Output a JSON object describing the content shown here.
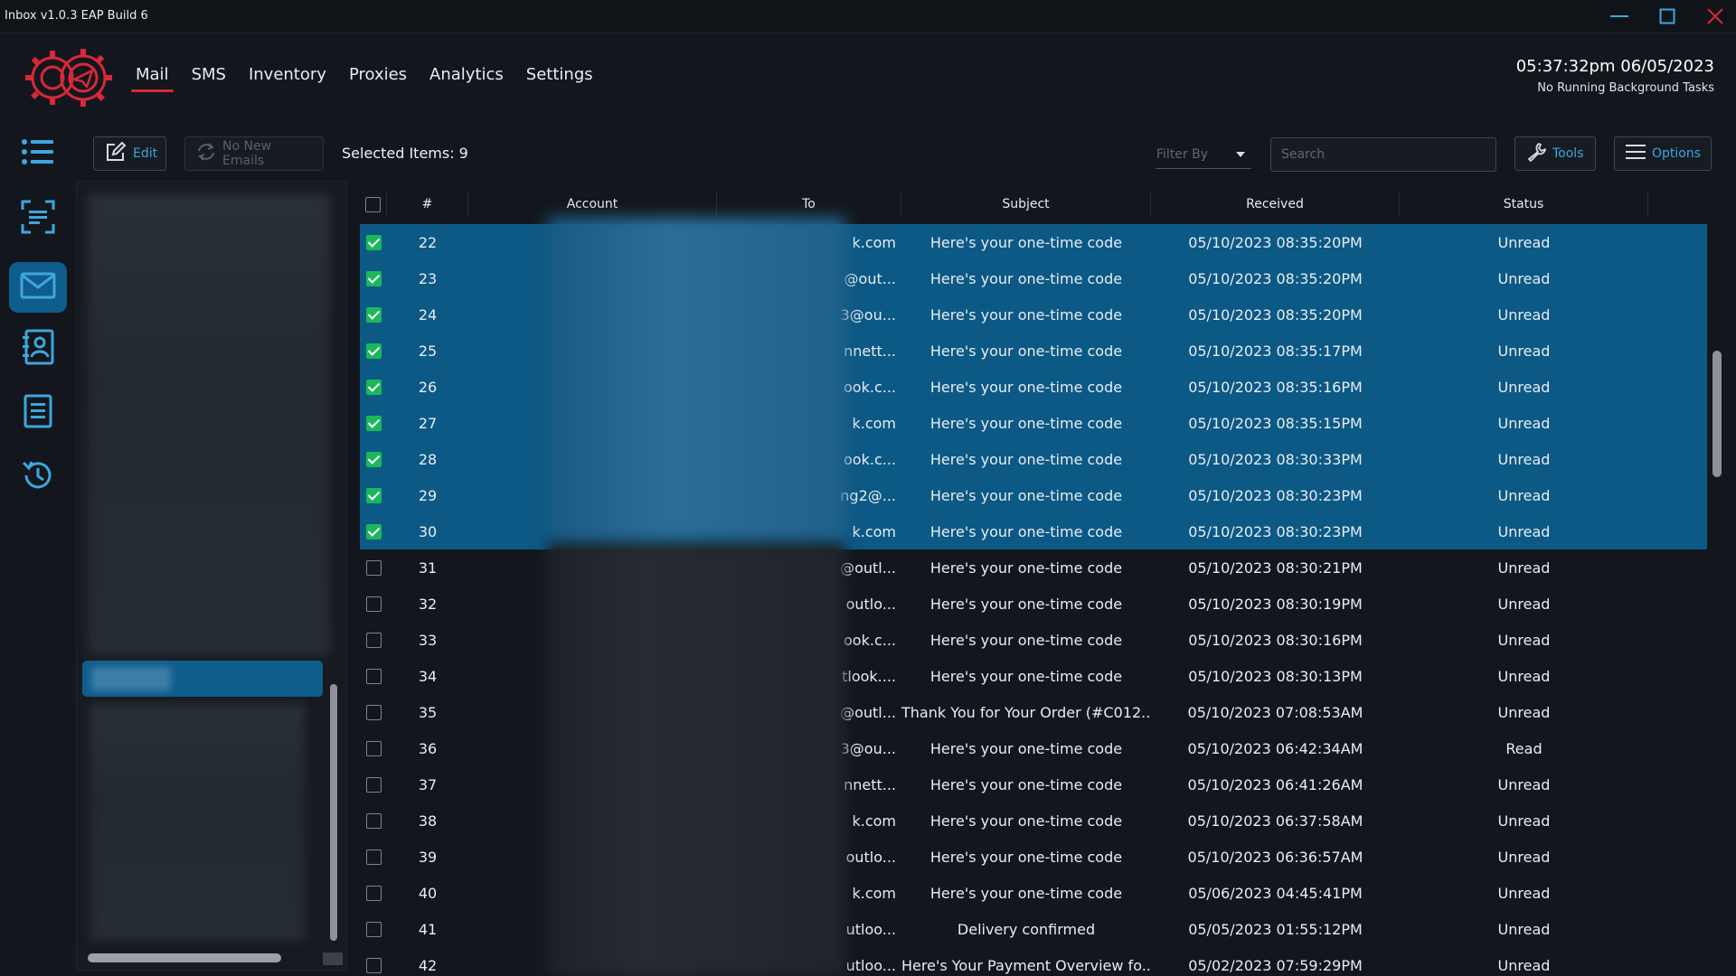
{
  "app": {
    "title": "Inbox v1.0.3 EAP Build 6"
  },
  "nav": {
    "items": [
      {
        "label": "Mail",
        "active": true
      },
      {
        "label": "SMS"
      },
      {
        "label": "Inventory"
      },
      {
        "label": "Proxies"
      },
      {
        "label": "Analytics"
      },
      {
        "label": "Settings"
      }
    ]
  },
  "clock": {
    "time": "05:37:32pm 06/05/2023",
    "status": "No Running Background Tasks"
  },
  "sidebar": {
    "icons": [
      "list-icon",
      "scan-text-icon",
      "mail-icon",
      "contacts-icon",
      "document-icon",
      "history-icon"
    ],
    "active": "mail-icon"
  },
  "toolbar": {
    "edit_label": "Edit",
    "refresh_label": "No New Emails",
    "selected_label": "Selected Items: 9",
    "filter_placeholder": "Filter By",
    "search_placeholder": "Search",
    "tools_label": "Tools",
    "options_label": "Options"
  },
  "table": {
    "headers": {
      "num": "#",
      "account": "Account",
      "to": "To",
      "subject": "Subject",
      "received": "Received",
      "status": "Status"
    },
    "rows": [
      {
        "num": "22",
        "to": "k.com",
        "subject": "Here's your one-time code",
        "received": "05/10/2023 08:35:20PM",
        "status": "Unread",
        "checked": true
      },
      {
        "num": "23",
        "to": "@out...",
        "subject": "Here's your one-time code",
        "received": "05/10/2023 08:35:20PM",
        "status": "Unread",
        "checked": true
      },
      {
        "num": "24",
        "to": "3@ou...",
        "subject": "Here's your one-time code",
        "received": "05/10/2023 08:35:20PM",
        "status": "Unread",
        "checked": true
      },
      {
        "num": "25",
        "to": "nnett...",
        "subject": "Here's your one-time code",
        "received": "05/10/2023 08:35:17PM",
        "status": "Unread",
        "checked": true
      },
      {
        "num": "26",
        "to": "ook.c...",
        "subject": "Here's your one-time code",
        "received": "05/10/2023 08:35:16PM",
        "status": "Unread",
        "checked": true
      },
      {
        "num": "27",
        "to": "k.com",
        "subject": "Here's your one-time code",
        "received": "05/10/2023 08:35:15PM",
        "status": "Unread",
        "checked": true
      },
      {
        "num": "28",
        "to": "ook.c...",
        "subject": "Here's your one-time code",
        "received": "05/10/2023 08:30:33PM",
        "status": "Unread",
        "checked": true
      },
      {
        "num": "29",
        "to": "ng2@...",
        "subject": "Here's your one-time code",
        "received": "05/10/2023 08:30:23PM",
        "status": "Unread",
        "checked": true
      },
      {
        "num": "30",
        "to": "k.com",
        "subject": "Here's your one-time code",
        "received": "05/10/2023 08:30:23PM",
        "status": "Unread",
        "checked": true
      },
      {
        "num": "31",
        "to": "@outl...",
        "subject": "Here's your one-time code",
        "received": "05/10/2023 08:30:21PM",
        "status": "Unread",
        "checked": false
      },
      {
        "num": "32",
        "to": "outlo...",
        "subject": "Here's your one-time code",
        "received": "05/10/2023 08:30:19PM",
        "status": "Unread",
        "checked": false
      },
      {
        "num": "33",
        "to": "ook.c...",
        "subject": "Here's your one-time code",
        "received": "05/10/2023 08:30:16PM",
        "status": "Unread",
        "checked": false
      },
      {
        "num": "34",
        "to": "tlook....",
        "subject": "Here's your one-time code",
        "received": "05/10/2023 08:30:13PM",
        "status": "Unread",
        "checked": false
      },
      {
        "num": "35",
        "to": "@outl...",
        "subject": "Thank You for Your Order (#C012...",
        "received": "05/10/2023 07:08:53AM",
        "status": "Unread",
        "checked": false
      },
      {
        "num": "36",
        "to": "3@ou...",
        "subject": "Here's your one-time code",
        "received": "05/10/2023 06:42:34AM",
        "status": "Read",
        "checked": false
      },
      {
        "num": "37",
        "to": "nnett...",
        "subject": "Here's your one-time code",
        "received": "05/10/2023 06:41:26AM",
        "status": "Unread",
        "checked": false
      },
      {
        "num": "38",
        "to": "k.com",
        "subject": "Here's your one-time code",
        "received": "05/10/2023 06:37:58AM",
        "status": "Unread",
        "checked": false
      },
      {
        "num": "39",
        "to": "outlo...",
        "subject": "Here's your one-time code",
        "received": "05/10/2023 06:36:57AM",
        "status": "Unread",
        "checked": false
      },
      {
        "num": "40",
        "to": "k.com",
        "subject": "Here's your one-time code",
        "received": "05/06/2023 04:45:41PM",
        "status": "Unread",
        "checked": false
      },
      {
        "num": "41",
        "to": "utloo...",
        "subject": "Delivery confirmed",
        "received": "05/05/2023 01:55:12PM",
        "status": "Unread",
        "checked": false
      },
      {
        "num": "42",
        "to": "utloo...",
        "subject": "Here's Your Payment Overview fo...",
        "received": "05/02/2023 07:59:29PM",
        "status": "Unread",
        "checked": false
      }
    ]
  },
  "colors": {
    "accent": "#3ea6dd",
    "selected_row": "#0c5985",
    "active_tab_underline": "#d8283a",
    "checkbox_on": "#1bb85a"
  }
}
